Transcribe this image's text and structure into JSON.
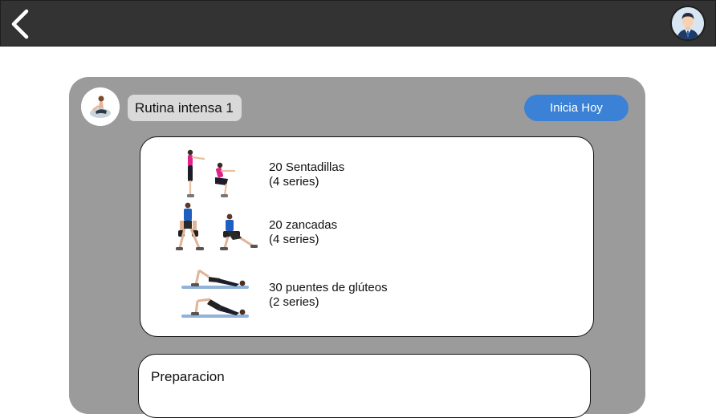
{
  "header": {
    "back_icon": "chevron-left-icon",
    "user_avatar_icon": "businessman-avatar-icon"
  },
  "routine": {
    "title": "Rutina intensa 1",
    "start_label": "Inicia Hoy",
    "coach_avatar_icon": "stretching-woman-avatar",
    "exercises": [
      {
        "name": "20 Sentadillas",
        "sets": "(4 series)",
        "icon": "squat-illustration"
      },
      {
        "name": "20 zancadas",
        "sets": "(4 series)",
        "icon": "lunge-illustration"
      },
      {
        "name": "30 puentes de glúteos",
        "sets": "(2 series)",
        "icon": "glute-bridge-illustration"
      }
    ]
  },
  "preparation": {
    "title": "Preparacion"
  },
  "colors": {
    "topbar": "#333333",
    "card": "#9b9b9b",
    "accent": "#3b82d6"
  }
}
